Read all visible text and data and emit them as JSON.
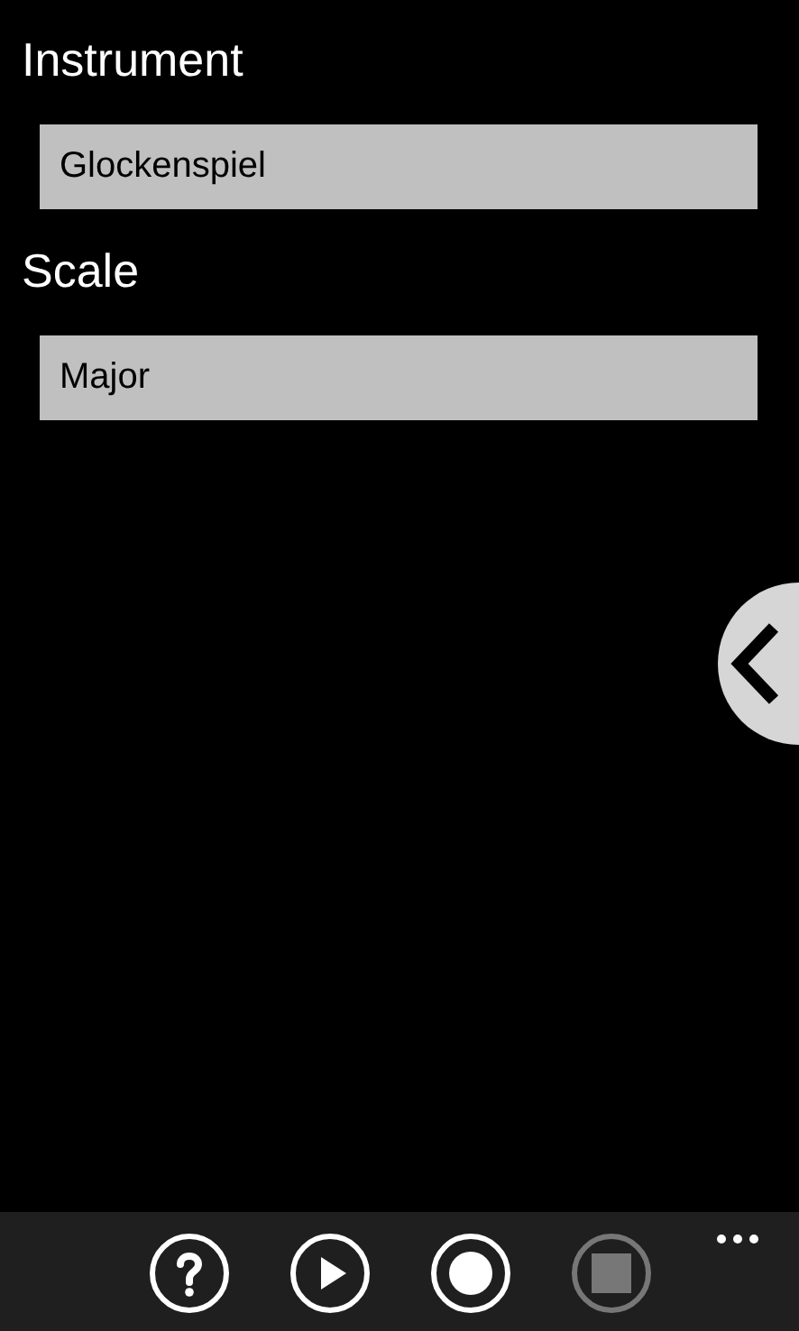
{
  "fields": [
    {
      "label": "Instrument",
      "value": "Glockenspiel"
    },
    {
      "label": "Scale",
      "value": "Major"
    }
  ],
  "side_tab": {
    "expanded": false
  },
  "app_bar": {
    "buttons": [
      {
        "kind": "help",
        "disabled": false
      },
      {
        "kind": "play",
        "disabled": false
      },
      {
        "kind": "record",
        "disabled": false
      },
      {
        "kind": "stop",
        "disabled": true
      }
    ],
    "more": true
  }
}
